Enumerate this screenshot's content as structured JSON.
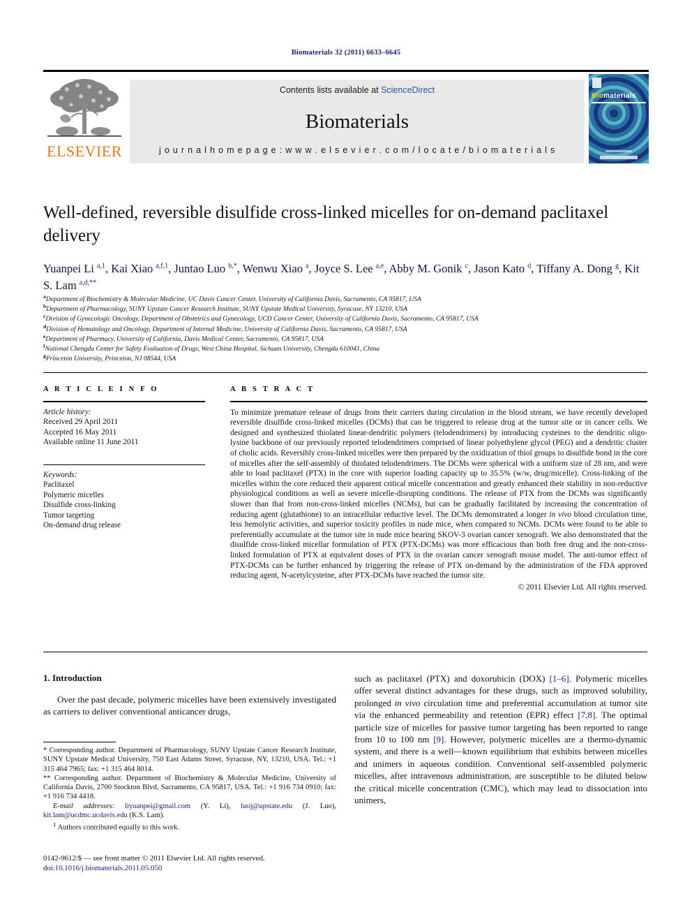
{
  "running_head": "Biomaterials 32 (2011) 6633–6645",
  "masthead": {
    "contents_prefix": "Contents lists available at ",
    "contents_link": "ScienceDirect",
    "journal_name": "Biomaterials",
    "homepage": "j o u r n a l   h o m e p a g e :   w w w . e l s e v i e r . c o m / l o c a t e / b i o m a t e r i a l s",
    "publisher_name": "ELSEVIER",
    "cover_title_part1": "Bio",
    "cover_title_part2": "materials",
    "accent_link_color": "#2b54a8",
    "publisher_color": "#e8761b"
  },
  "article": {
    "title": "Well-defined, reversible disulfide cross-linked micelles for on-demand paclitaxel delivery",
    "authors_html": "Yuanpei Li <sup>a,1</sup>, Kai Xiao <sup>a,f,1</sup>, Juntao Luo <sup>b,*</sup>, Wenwu Xiao <sup>a</sup>, Joyce S. Lee <sup>a,e</sup>, Abby M. Gonik <sup>c</sup>, Jason Kato <sup>d</sup>, Tiffany A. Dong <sup>g</sup>, Kit S. Lam <sup>a,d,**</sup>",
    "affiliations": [
      {
        "mark": "a",
        "text": "Department of Biochemistry & Molecular Medicine, UC Davis Cancer Center, University of California Davis, Sacramento, CA 95817, USA"
      },
      {
        "mark": "b",
        "text": "Department of Pharmacology, SUNY Upstate Cancer Research Institute, SUNY Upstate Medical University, Syracuse, NY 13210, USA"
      },
      {
        "mark": "c",
        "text": "Division of Gynecologic Oncology, Department of Obstetrics and Gynecology, UCD Cancer Center, University of California Davis, Sacramento, CA 95817, USA"
      },
      {
        "mark": "d",
        "text": "Division of Hematology and Oncology, Department of Internal Medicine, University of California Davis, Sacramento, CA 95817, USA"
      },
      {
        "mark": "e",
        "text": "Department of Pharmacy, University of California, Davis Medical Center, Sacramento, CA 95817, USA"
      },
      {
        "mark": "f",
        "text": "National Chengdu Center for Safety Evaluation of Drugs, West China Hospital, Sichuan University, Chengdu 610041, China"
      },
      {
        "mark": "g",
        "text": "Princeton University, Princeton, NJ 08544, USA"
      }
    ]
  },
  "article_info": {
    "heading": "A R T I C L E  I N F O",
    "history_label": "Article history:",
    "history": [
      "Received 29 April 2011",
      "Accepted 16 May 2011",
      "Available online 11 June 2011"
    ],
    "keywords_label": "Keywords:",
    "keywords": [
      "Paclitaxel",
      "Polymeric micelles",
      "Disulfide cross-linking",
      "Tumor targeting",
      "On-demand drug release"
    ]
  },
  "abstract": {
    "heading": "A B S T R A C T",
    "text_html": "To minimize premature release of drugs from their carriers during circulation in the blood stream, we have recently developed reversible disulfide cross-linked micelles (DCMs) that can be triggered to release drug at the tumor site or in cancer cells. We designed and synthesized thiolated linear-dendritic polymers (telodendrimers) by introducing cysteines to the dendritic oligo-lysine backbone of our previously reported telodendrimers comprised of linear polyethylene glycol (PEG) and a dendritic cluster of cholic acids. Reversibly cross-linked micelles were then prepared by the oxidization of thiol groups to disulfide bond in the core of micelles after the self-assembly of thiolated telodendrimers. The DCMs were spherical with a uniform size of 28 nm, and were able to load paclitaxel (PTX) in the core with superior loading capacity up to 35.5% (w/w, drug/micelle). Cross-linking of the micelles within the core reduced their apparent critical micelle concentration and greatly enhanced their stability in non-reductive physiological conditions as well as severe micelle-disrupting conditions. The release of PTX from the DCMs was significantly slower than that from non-cross-linked micelles (NCMs), but can be gradually facilitated by increasing the concentration of reducing agent (glutathione) to an intracellular reductive level. The DCMs demonstrated a longer <i>in vivo</i> blood circulation time, less hemolytic activities, and superior toxicity profiles in nude mice, when compared to NCMs. DCMs were found to be able to preferentially accumulate at the tumor site in nude mice bearing SKOV-3 ovarian cancer xenograft. We also demonstrated that the disulfide cross-linked micellar formulation of PTX (PTX-DCMs) was more efficacious than both free drug and the non-cross-linked formulation of PTX at equivalent doses of PTX in the ovarian cancer xenograft mouse model. The anti-tumor effect of PTX-DCMs can be further enhanced by triggering the release of PTX on-demand by the administration of the FDA approved reducing agent, N-acetylcysteine, after PTX-DCMs have reached the tumor site.",
    "copyright": "© 2011 Elsevier Ltd. All rights reserved."
  },
  "body": {
    "section_number_title": "1.  Introduction",
    "left_paragraph": "Over the past decade, polymeric micelles have been extensively investigated as carriers to deliver conventional anticancer drugs,",
    "right_paragraph_html": "such as paclitaxel (PTX) and doxorubicin (DOX) <span class=\"ref\">[1–6]</span>. Polymeric micelles offer several distinct advantages for these drugs, such as improved solubility, prolonged <i>in vivo</i> circulation time and preferential accumulation at tumor site via the enhanced permeability and retention (EPR) effect <span class=\"ref\">[7,8]</span>. The optimal particle size of micelles for passive tumor targeting has been reported to range from 10 to 100 nm <span class=\"ref\">[9]</span>. However, polymeric micelles are a thermo-dynamic system, and there is a well—known equilibrium that exhibits between micelles and unimers in aqueous condition. Conventional self-assembled polymeric micelles, after intravenous administration, are susceptible to be diluted below the critical micelle concentration (CMC), which may lead to dissociation into unimers,"
  },
  "footnotes": {
    "corr1_html": "<span class=\"fn-mark\">*</span> Corresponding author. Department of Pharmacology, SUNY Upstate Cancer Research Institute, SUNY Upstate Medical University, 750 East Adams Street, Syracuse, NY, 13210, USA. Tel.: +1 315 464 7965; fax: +1 315 464 8014.",
    "corr2_html": "<span class=\"fn-mark\">**</span> Corresponding author. Department of Biochemistry & Molecular Medicine, University of California Davis, 2700 Stockton Blvd, Sacramento, CA 95817, USA. Tel.: +1 916 734 0910; fax: +1 916 734 4418.",
    "emails_html": "<span class=\"it\">E-mail addresses:</span> <span class=\"email\">liyuanpei@gmail.com</span> (Y. Li), <span class=\"email\">luoj@upstate.edu</span> (J. Luo), <span class=\"email\">kit.lam@ucdmc.ucdavis.edu</span> (K.S. Lam).",
    "equal_contrib_html": "<sup>1</sup>  Authors contributed equally to this work."
  },
  "imprint": {
    "line1": "0142-9612/$ — see front matter © 2011 Elsevier Ltd. All rights reserved.",
    "doi_label": "doi:",
    "doi_value": "10.1016/j.biomaterials.2011.05.050"
  }
}
